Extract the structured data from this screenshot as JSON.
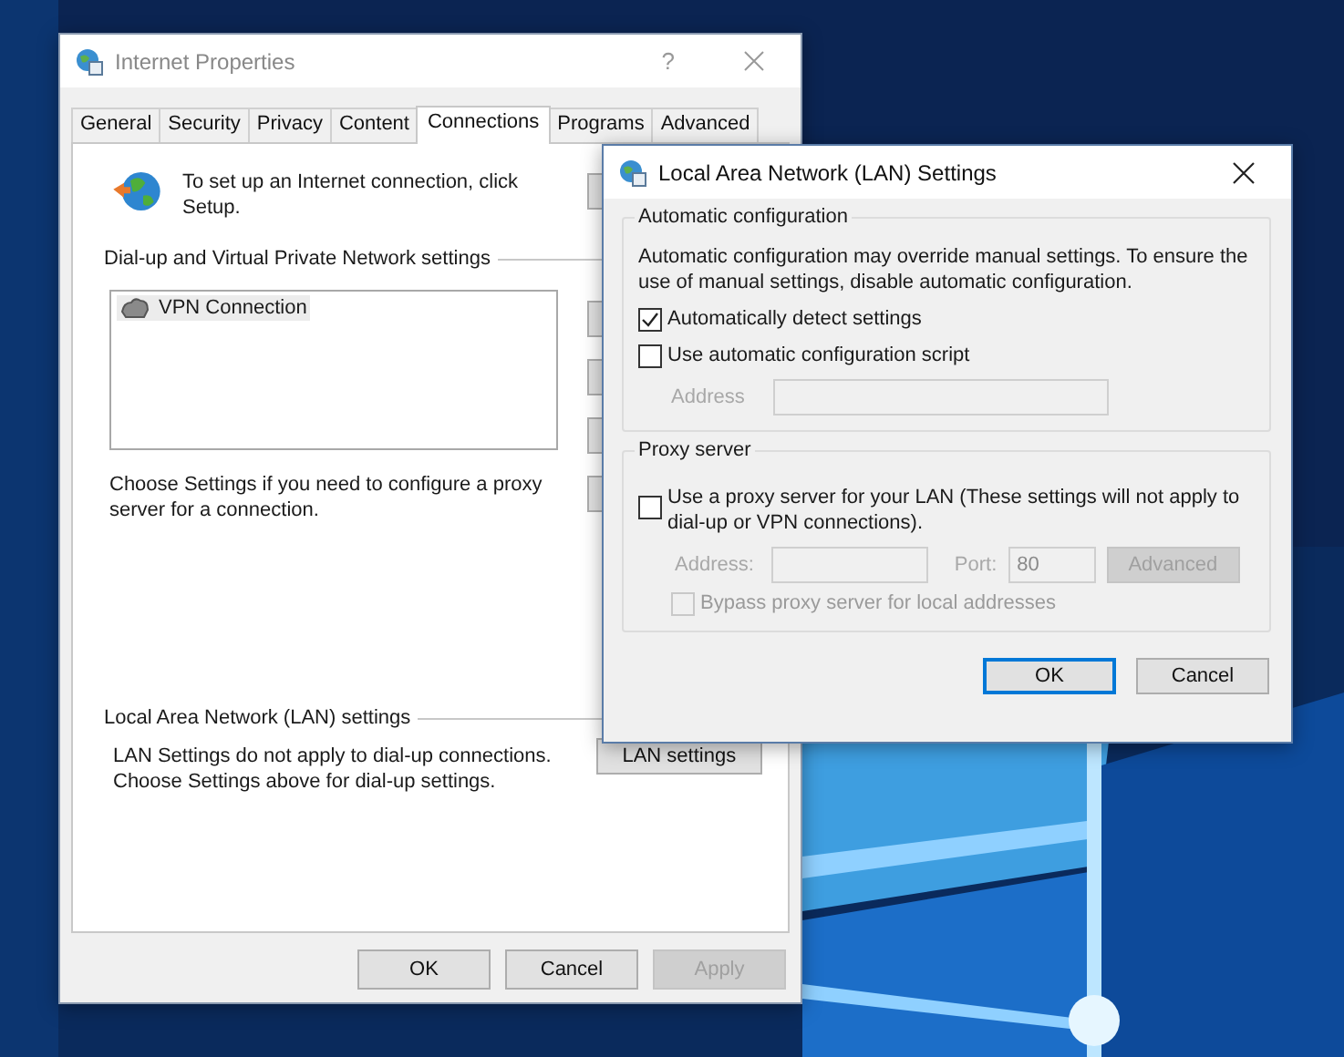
{
  "internet_properties": {
    "title": "Internet Properties",
    "help": "?",
    "tabs": [
      {
        "label": "General",
        "selected": false
      },
      {
        "label": "Security",
        "selected": false
      },
      {
        "label": "Privacy",
        "selected": false
      },
      {
        "label": "Content",
        "selected": false
      },
      {
        "label": "Connections",
        "selected": true
      },
      {
        "label": "Programs",
        "selected": false
      },
      {
        "label": "Advanced",
        "selected": false
      }
    ],
    "setup_text": "To set up an Internet connection, click Setup.",
    "dialup_heading": "Dial-up and Virtual Private Network settings",
    "connections": [
      {
        "name": "VPN Connection",
        "selected": true
      }
    ],
    "proxy_note": "Choose Settings if you need to configure a proxy server for a connection.",
    "lan_heading": "Local Area Network (LAN) settings",
    "lan_note": "LAN Settings do not apply to dial-up connections. Choose Settings above for dial-up settings.",
    "lan_button": "LAN settings",
    "buttons": [
      {
        "label": "OK",
        "disabled": false
      },
      {
        "label": "Cancel",
        "disabled": false
      },
      {
        "label": "Apply",
        "disabled": true
      }
    ]
  },
  "lan_dialog": {
    "title": "Local Area Network (LAN) Settings",
    "auto_group": {
      "legend": "Automatic configuration",
      "description": "Automatic configuration may override manual settings.  To ensure the use of manual settings, disable automatic configuration.",
      "options": [
        {
          "label": "Automatically detect settings",
          "checked": true,
          "disabled": false
        },
        {
          "label": "Use automatic configuration script",
          "checked": false,
          "disabled": false
        }
      ],
      "address_label": "Address",
      "address_disabled": true
    },
    "proxy_group": {
      "legend": "Proxy server",
      "option": {
        "label": "Use a proxy server for your LAN (These settings will not apply to dial-up or VPN connections).",
        "checked": false
      },
      "address_label": "Address:",
      "port_label": "Port:",
      "port_value": "80",
      "fields_disabled": true,
      "advanced_button": {
        "label": "Advanced",
        "disabled": true
      },
      "bypass": {
        "label": "Bypass proxy server for local addresses",
        "checked": false,
        "disabled": true
      }
    },
    "buttons": [
      {
        "label": "OK",
        "default": true
      },
      {
        "label": "Cancel",
        "default": false
      }
    ]
  }
}
